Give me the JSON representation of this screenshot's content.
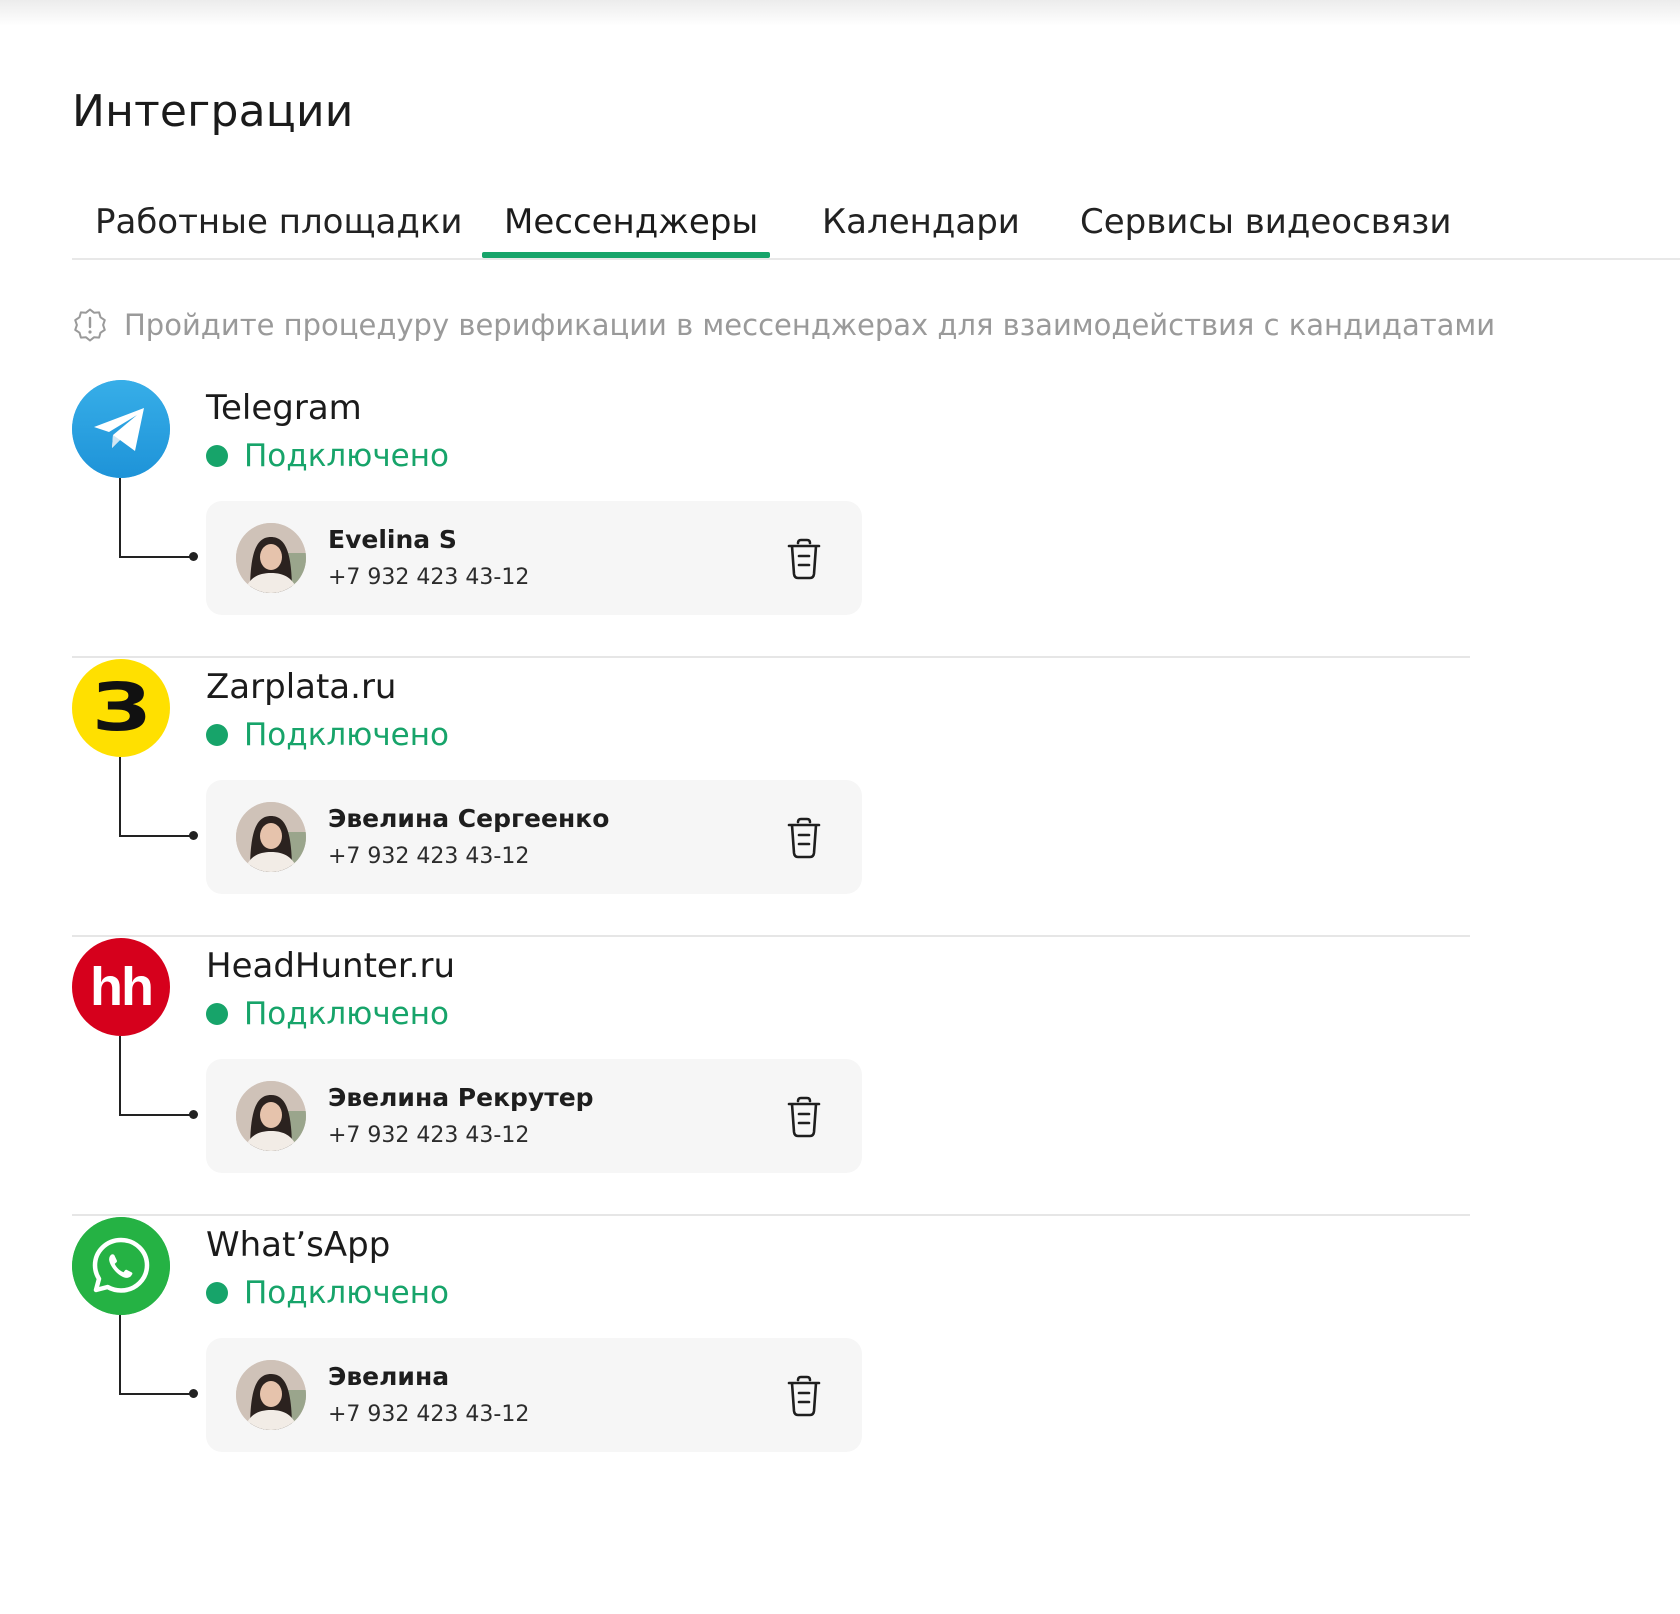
{
  "page": {
    "title": "Интеграции"
  },
  "tabs": [
    {
      "label": "Работные площадки",
      "active": false
    },
    {
      "label": "Мессенджеры",
      "active": true
    },
    {
      "label": "Календари",
      "active": false
    },
    {
      "label": "Сервисы видеосвязи",
      "active": false
    }
  ],
  "notice": {
    "icon": "warning-badge-icon",
    "text": "Пройдите процедуру верификации в мессенджерах для взаимодействия с кандидатами"
  },
  "colors": {
    "accent": "#17a46a",
    "telegram": "#2aa0e3",
    "zarplata": "#ffe000",
    "headhunter": "#d6001c",
    "whatsapp": "#25b244"
  },
  "integrations": [
    {
      "service": "Telegram",
      "logo_icon": "telegram-logo-icon",
      "status": "Подключено",
      "account": {
        "name": "Evelina S",
        "phone": "+7 932 423 43-12"
      }
    },
    {
      "service": "Zarplata.ru",
      "logo_icon": "zarplata-logo-icon",
      "logo_text": "З",
      "status": "Подключено",
      "account": {
        "name": "Эвелина Сергеенко",
        "phone": "+7 932 423 43-12"
      }
    },
    {
      "service": "HeadHunter.ru",
      "logo_icon": "headhunter-logo-icon",
      "logo_text": "hh",
      "status": "Подключено",
      "account": {
        "name": "Эвелина Рекрутер",
        "phone": "+7 932 423 43-12"
      }
    },
    {
      "service": "What’sApp",
      "logo_icon": "whatsapp-logo-icon",
      "status": "Подключено",
      "account": {
        "name": "Эвелина",
        "phone": "+7 932 423 43-12"
      }
    }
  ]
}
